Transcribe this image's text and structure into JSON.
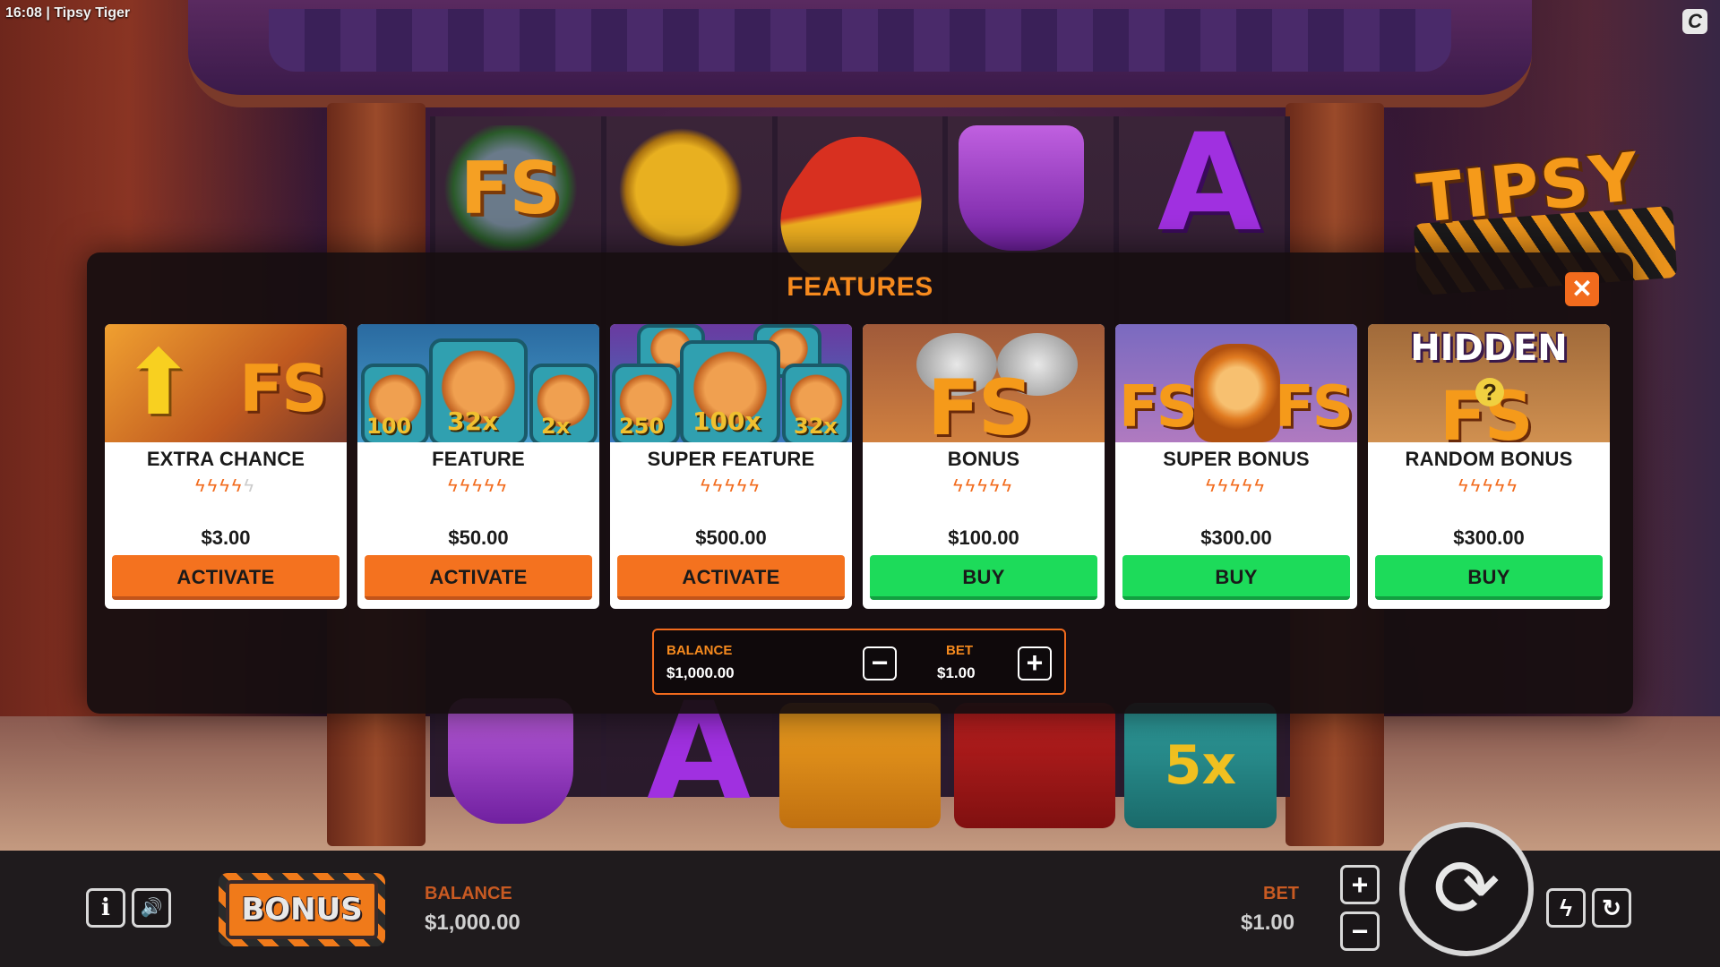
{
  "status": {
    "time": "16:08",
    "separator": "|",
    "game_title": "Tipsy Tiger"
  },
  "corner_logo": "C",
  "logo": {
    "line1": "TIPSY"
  },
  "modal": {
    "title": "FEATURES",
    "close_symbol": "✕",
    "cards": [
      {
        "name": "EXTRA CHANCE",
        "bolts_lit": 4,
        "bolts_total": 5,
        "price": "$3.00",
        "action": "ACTIVATE",
        "action_style": "orange",
        "art": {
          "fs": "FS"
        }
      },
      {
        "name": "FEATURE",
        "bolts_lit": 5,
        "bolts_total": 5,
        "price": "$50.00",
        "action": "ACTIVATE",
        "action_style": "orange",
        "art": {
          "multipliers": [
            "100",
            "32x",
            "2x"
          ]
        }
      },
      {
        "name": "SUPER FEATURE",
        "bolts_lit": 5,
        "bolts_total": 5,
        "price": "$500.00",
        "action": "ACTIVATE",
        "action_style": "orange",
        "art": {
          "multipliers": [
            "250",
            "100x",
            "32x"
          ]
        }
      },
      {
        "name": "BONUS",
        "bolts_lit": 5,
        "bolts_total": 5,
        "price": "$100.00",
        "action": "BUY",
        "action_style": "green",
        "art": {
          "fs": "FS"
        }
      },
      {
        "name": "SUPER BONUS",
        "bolts_lit": 5,
        "bolts_total": 5,
        "price": "$300.00",
        "action": "BUY",
        "action_style": "green",
        "art": {
          "fs": "FS"
        }
      },
      {
        "name": "RANDOM BONUS",
        "bolts_lit": 5,
        "bolts_total": 5,
        "price": "$300.00",
        "action": "BUY",
        "action_style": "green",
        "art": {
          "banner": "HIDDEN",
          "fs": "FS",
          "mystery": "?"
        }
      }
    ],
    "panel": {
      "balance_label": "BALANCE",
      "balance_value": "$1,000.00",
      "bet_label": "BET",
      "bet_value": "$1.00",
      "minus": "−",
      "plus": "+"
    }
  },
  "reel_symbols": {
    "top_fs": "FS",
    "top_a": "A",
    "bottom_a": "A",
    "bottom_mult": "5x"
  },
  "bottom_bar": {
    "info_icon": "i",
    "sound_icon": "🔊",
    "bonus_label": "BONUS",
    "balance_label": "BALANCE",
    "balance_value": "$1,000.00",
    "bet_label": "BET",
    "bet_value": "$1.00",
    "bet_plus": "+",
    "bet_minus": "−",
    "spin_icon": "⟳",
    "turbo_icon": "ϟ",
    "autoplay_icon": "↻"
  },
  "colors": {
    "accent": "#f68a1e",
    "orange_button": "#f4721f",
    "green_button": "#1ddb5a",
    "modal_bg": "#160e10"
  }
}
